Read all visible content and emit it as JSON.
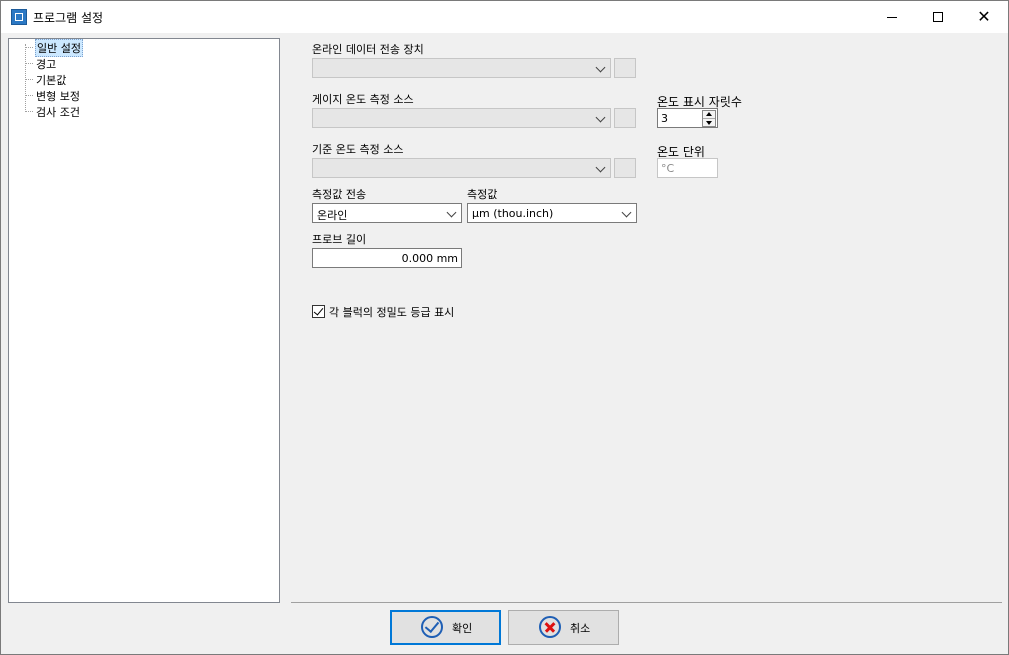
{
  "window": {
    "title": "프로그램 설정",
    "icon": "settings-app-icon"
  },
  "tree": {
    "items": [
      {
        "label": "일반 설정",
        "selected": true
      },
      {
        "label": "경고"
      },
      {
        "label": "기본값"
      },
      {
        "label": "변형 보정"
      },
      {
        "label": "검사 조건"
      }
    ]
  },
  "general": {
    "online_device_label": "온라인 데이터 전송 장치",
    "gauge_source_label": "게이지 온도 측정 소스",
    "reference_source_label": "기준 온도 측정 소스",
    "transfer_label": "측정값 전송",
    "transfer_value": "온라인",
    "measured_label": "측정값",
    "measured_value": "µm (thou.inch)",
    "probe_length_label": "프로브 길이",
    "probe_length_value": "0.000 mm",
    "temp_digits_label": "온도 표시 자릿수",
    "temp_digits_value": "3",
    "temp_unit_label": "온도 단위",
    "temp_unit_value": "°C",
    "show_grade_label": "각 블럭의 정밀도 등급 표시",
    "show_grade_checked": true
  },
  "buttons": {
    "ok": "확인",
    "cancel": "취소"
  }
}
